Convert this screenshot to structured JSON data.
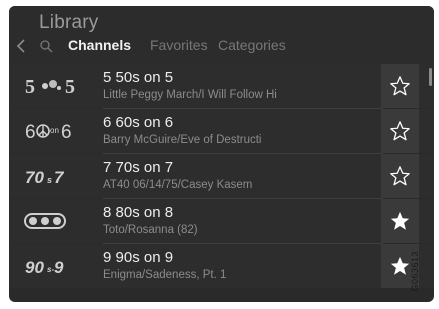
{
  "header": {
    "title": "Library",
    "tabs": [
      {
        "label": "Channels",
        "active": true
      },
      {
        "label": "Favorites",
        "active": false
      },
      {
        "label": "Categories",
        "active": false
      }
    ]
  },
  "channels": [
    {
      "logo_text": "5···5",
      "name": "5 50s on 5",
      "now_playing": "Little Peggy March/I Will Follow Hi",
      "favorite": false
    },
    {
      "logo_text": "6☮·6",
      "name": "6 60s on 6",
      "now_playing": "Barry McGuire/Eve of Destructi",
      "favorite": false
    },
    {
      "logo_text": "70s7",
      "name": "7 70s on 7",
      "now_playing": "AT40 06/14/75/Casey Kasem",
      "favorite": false
    },
    {
      "logo_text": "8···8",
      "name": "8 80s on 8",
      "now_playing": "Toto/Rosanna (82)",
      "favorite": true
    },
    {
      "logo_text": "90s9",
      "name": "9 90s on 9",
      "now_playing": "Enigma/Sadeness, Pt. 1",
      "favorite": true
    }
  ],
  "image_code": "G063613",
  "colors": {
    "background": "#2a2a2a",
    "text_primary": "#ededed",
    "text_secondary": "#8c8c8c",
    "star": "#ffffff"
  }
}
